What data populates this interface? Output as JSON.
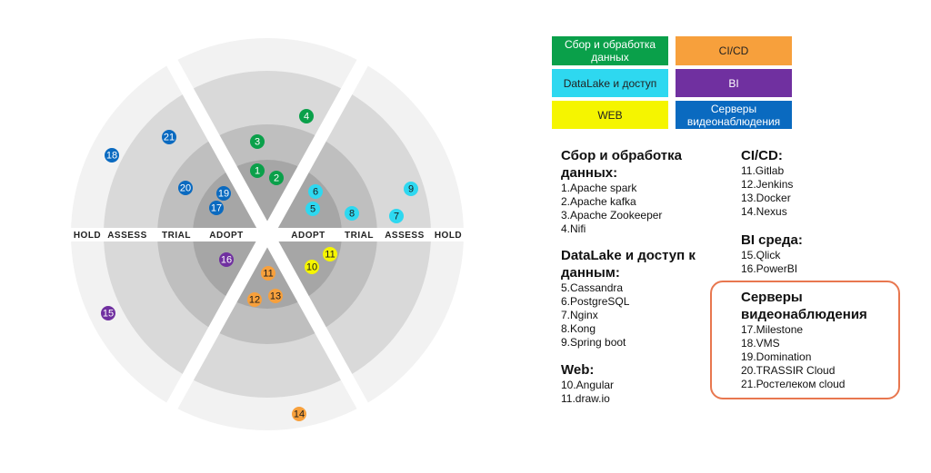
{
  "radar": {
    "rings_left": [
      "HOLD",
      "ASSESS",
      "TRIAL",
      "ADOPT"
    ],
    "rings_right": [
      "ADOPT",
      "TRIAL",
      "ASSESS",
      "HOLD"
    ],
    "blips": [
      {
        "id": "1",
        "category": "data",
        "ring": "ADOPT"
      },
      {
        "id": "2",
        "category": "data",
        "ring": "ADOPT"
      },
      {
        "id": "3",
        "category": "data",
        "ring": "TRIAL"
      },
      {
        "id": "4",
        "category": "data",
        "ring": "ASSESS"
      },
      {
        "id": "5",
        "category": "datalake",
        "ring": "ADOPT"
      },
      {
        "id": "6",
        "category": "datalake",
        "ring": "ADOPT"
      },
      {
        "id": "7",
        "category": "datalake",
        "ring": "ASSESS"
      },
      {
        "id": "8",
        "category": "datalake",
        "ring": "TRIAL"
      },
      {
        "id": "9",
        "category": "datalake",
        "ring": "ASSESS"
      },
      {
        "id": "10",
        "category": "web",
        "ring": "ADOPT"
      },
      {
        "id": "11",
        "category": "web",
        "ring": "ADOPT"
      },
      {
        "id": "11",
        "category": "cicd",
        "ring": "ADOPT"
      },
      {
        "id": "12",
        "category": "cicd",
        "ring": "ADOPT"
      },
      {
        "id": "13",
        "category": "cicd",
        "ring": "ADOPT"
      },
      {
        "id": "14",
        "category": "cicd",
        "ring": "HOLD"
      },
      {
        "id": "15",
        "category": "bi",
        "ring": "HOLD"
      },
      {
        "id": "16",
        "category": "bi",
        "ring": "ADOPT"
      },
      {
        "id": "17",
        "category": "video",
        "ring": "ADOPT"
      },
      {
        "id": "18",
        "category": "video",
        "ring": "HOLD"
      },
      {
        "id": "19",
        "category": "video",
        "ring": "ADOPT"
      },
      {
        "id": "20",
        "category": "video",
        "ring": "TRIAL"
      },
      {
        "id": "21",
        "category": "video",
        "ring": "ASSESS"
      }
    ]
  },
  "colors": {
    "data": "#0aa04a",
    "datalake": "#2ed8f0",
    "web": "#f5f500",
    "cicd": "#f7a03c",
    "bi": "#7030a0",
    "video": "#0a6ac0",
    "ring_hold": "#f2f2f2",
    "ring_assess": "#d9d9d9",
    "ring_trial": "#bfbfbf",
    "ring_adopt": "#a6a6a6",
    "highlight_border": "#e8774f"
  },
  "legend": [
    {
      "key": "data",
      "label": "Сбор и обработка данных"
    },
    {
      "key": "cicd",
      "label": "CI/CD"
    },
    {
      "key": "datalake",
      "label": "DataLake и доступ"
    },
    {
      "key": "bi",
      "label": "BI"
    },
    {
      "key": "web",
      "label": "WEB"
    },
    {
      "key": "video",
      "label": "Серверы видеонаблюдения"
    }
  ],
  "lists": {
    "data": {
      "title": "Сбор и обработка данных:",
      "items": [
        "1.Apache spark",
        "2.Apache kafka",
        "3.Apache Zookeeper",
        "4.Nifi"
      ]
    },
    "datalake": {
      "title": "DataLake и доступ к данным:",
      "items": [
        "5.Cassandra",
        "6.PostgreSQL",
        "7.Nginx",
        "8.Kong",
        "9.Spring boot"
      ]
    },
    "web": {
      "title": "Web:",
      "items": [
        "10.Angular",
        "11.draw.io"
      ]
    },
    "cicd": {
      "title": "CI/CD:",
      "items": [
        "11.Gitlab",
        "12.Jenkins",
        "13.Docker",
        "14.Nexus"
      ]
    },
    "bi": {
      "title": "BI среда:",
      "items": [
        "15.Qlick",
        "16.PowerBI"
      ]
    },
    "video": {
      "title": "Серверы видеонаблюдения",
      "items": [
        "17.Milestone",
        "18.VMS",
        "19.Domination",
        "20.TRASSIR Cloud",
        "21.Ростелеком cloud"
      ]
    }
  }
}
